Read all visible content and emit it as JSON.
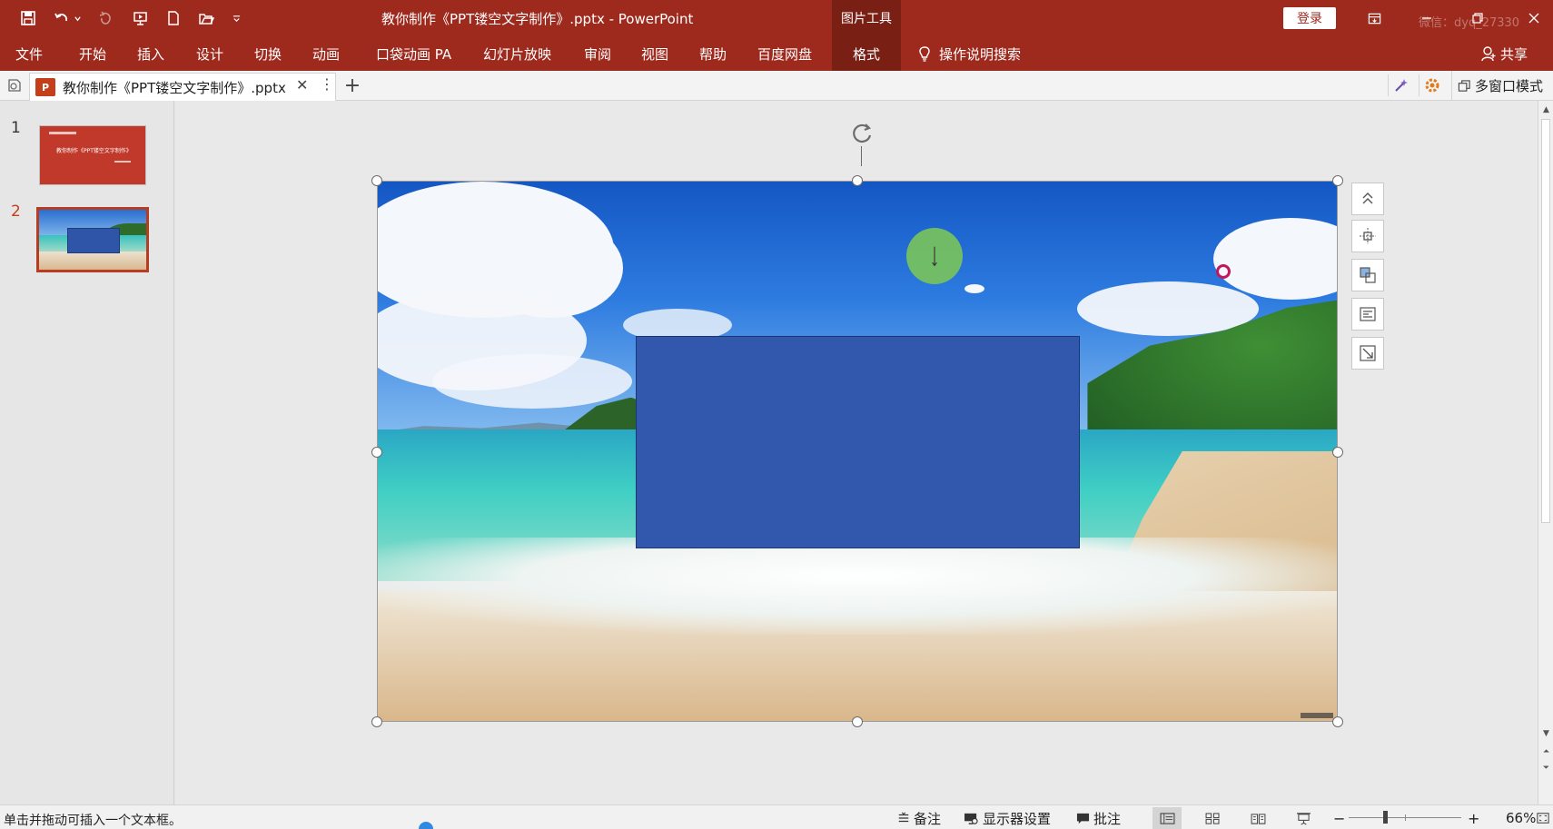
{
  "titlebar": {
    "doc_title": "教你制作《PPT镂空文字制作》.pptx  -  PowerPoint",
    "context_title": "图片工具",
    "login_label": "登录",
    "watermark": "微信：dyq_27330",
    "qa_icons": [
      "save-icon",
      "undo-icon",
      "redo-icon",
      "slideshow-from-start-icon",
      "new-file-icon",
      "open-folder-icon",
      "customize-qat-icon"
    ],
    "accent": "#9e2a1e"
  },
  "ribbon": {
    "tabs": [
      "文件",
      "开始",
      "插入",
      "设计",
      "切换",
      "动画",
      "口袋动画 PA",
      "幻灯片放映",
      "审阅",
      "视图",
      "帮助",
      "百度网盘"
    ],
    "active_tab": "格式",
    "tell_me": "操作说明搜索",
    "share": "共享"
  },
  "tabbar": {
    "doc_tab": "教你制作《PPT镂空文字制作》.pptx",
    "ppt_badge": "P",
    "add_label": "+",
    "close_label": "✕",
    "more_label": "⋮",
    "multiwin": "多窗口模式"
  },
  "thumbs": [
    {
      "num": "1",
      "title": "教你制作《PPT镂空文字制作》"
    },
    {
      "num": "2"
    }
  ],
  "slide": {
    "rect_color": "#3158ad"
  },
  "statusbar": {
    "text": "单击并拖动可插入一个文本框。",
    "notes": "备注",
    "display": "显示器设置",
    "comments": "批注",
    "zoom_minus": "−",
    "zoom_plus": "+",
    "zoom": "66%"
  }
}
